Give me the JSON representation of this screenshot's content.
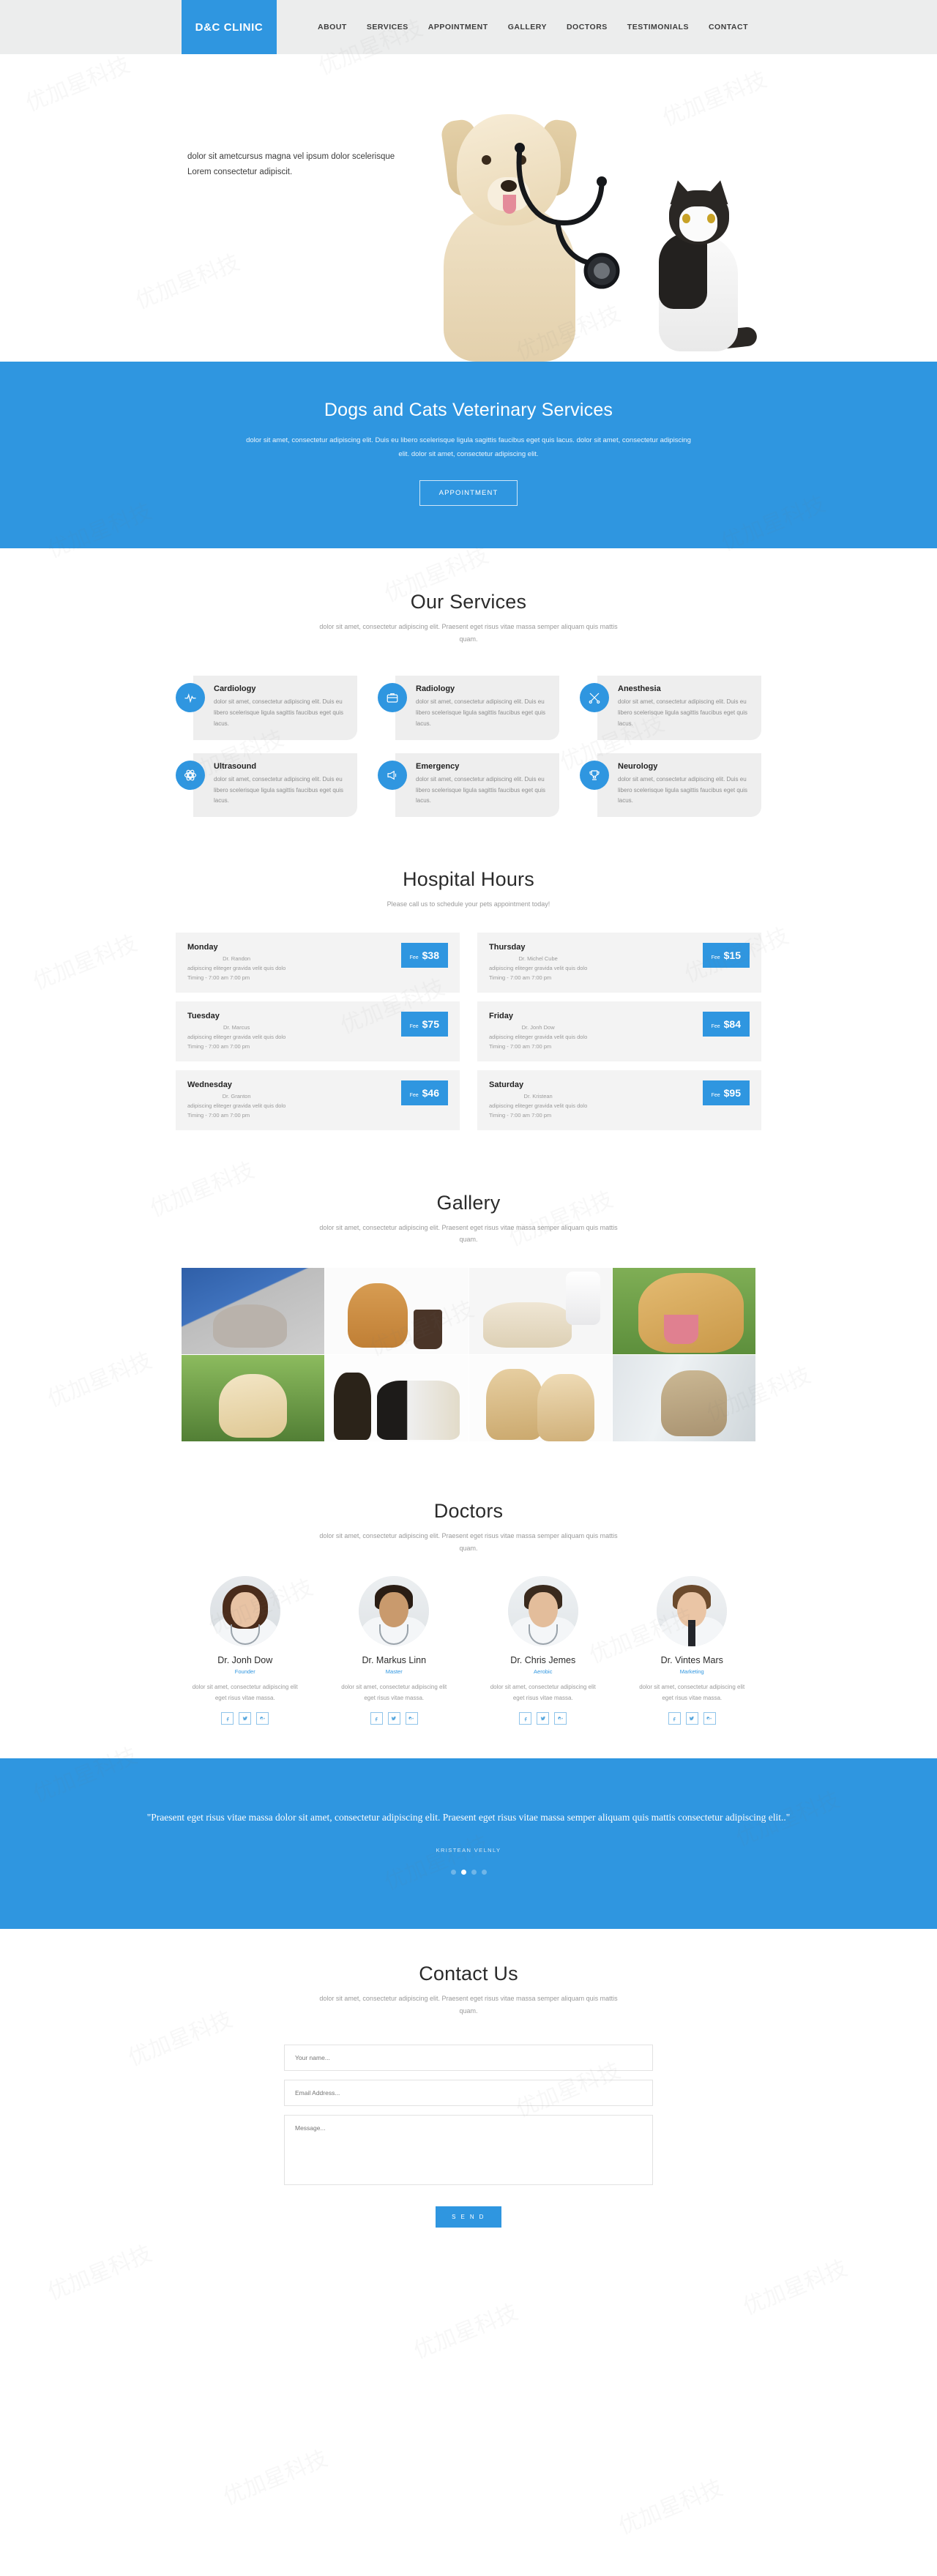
{
  "header": {
    "logo": "D&C CLINIC",
    "nav": [
      {
        "label": "ABOUT"
      },
      {
        "label": "SERVICES"
      },
      {
        "label": "APPOINTMENT"
      },
      {
        "label": "GALLERY"
      },
      {
        "label": "DOCTORS"
      },
      {
        "label": "TESTIMONIALS"
      },
      {
        "label": "CONTACT"
      }
    ]
  },
  "hero": {
    "line1": "dolor sit ametcursus magna vel ipsum dolor scelerisque",
    "line2": "Lorem consectetur adipiscit."
  },
  "banner": {
    "title": "Dogs and Cats Veterinary Services",
    "text": "dolor sit amet, consectetur adipiscing elit. Duis eu libero scelerisque ligula sagittis faucibus eget quis lacus. dolor sit amet, consectetur adipiscing elit. dolor sit amet, consectetur adipiscing elit.",
    "button": "APPOINTMENT"
  },
  "services": {
    "title": "Our Services",
    "subtitle": "dolor sit amet, consectetur adipiscing elit. Praesent eget risus vitae massa semper aliquam quis mattis quam.",
    "items": [
      {
        "icon": "heartbeat-icon",
        "title": "Cardiology",
        "text": "dolor sit amet, consectetur adipiscing elit. Duis eu libero scelerisque ligula sagittis faucibus eget quis lacus."
      },
      {
        "icon": "briefcase-icon",
        "title": "Radiology",
        "text": "dolor sit amet, consectetur adipiscing elit. Duis eu libero scelerisque ligula sagittis faucibus eget quis lacus."
      },
      {
        "icon": "scissors-icon",
        "title": "Anesthesia",
        "text": "dolor sit amet, consectetur adipiscing elit. Duis eu libero scelerisque ligula sagittis faucibus eget quis lacus."
      },
      {
        "icon": "atom-icon",
        "title": "Ultrasound",
        "text": "dolor sit amet, consectetur adipiscing elit. Duis eu libero scelerisque ligula sagittis faucibus eget quis lacus."
      },
      {
        "icon": "megaphone-icon",
        "title": "Emergency",
        "text": "dolor sit amet, consectetur adipiscing elit. Duis eu libero scelerisque ligula sagittis faucibus eget quis lacus."
      },
      {
        "icon": "trophy-icon",
        "title": "Neurology",
        "text": "dolor sit amet, consectetur adipiscing elit. Duis eu libero scelerisque ligula sagittis faucibus eget quis lacus."
      }
    ]
  },
  "hours": {
    "title": "Hospital Hours",
    "subtitle": "Please call us to schedule your pets appointment today!",
    "fee_label": "Fee",
    "items": [
      {
        "day": "Monday",
        "doctor": "Dr. Randon",
        "desc": "adipiscing eliteger gravida velit quis dolo",
        "timing": "Timing - 7:00 am 7:00 pm",
        "fee": "$38"
      },
      {
        "day": "Thursday",
        "doctor": "Dr. Michel Cube",
        "desc": "adipiscing eliteger gravida velit quis dolo",
        "timing": "Timing - 7:00 am 7:00 pm",
        "fee": "$15"
      },
      {
        "day": "Tuesday",
        "doctor": "Dr. Marcus",
        "desc": "adipiscing eliteger gravida velit quis dolo",
        "timing": "Timing - 7:00 am 7:00 pm",
        "fee": "$75"
      },
      {
        "day": "Friday",
        "doctor": "Dr. Jonh Dow",
        "desc": "adipiscing eliteger gravida velit quis dolo",
        "timing": "Timing - 7:00 am 7:00 pm",
        "fee": "$84"
      },
      {
        "day": "Wednesday",
        "doctor": "Dr. Granton",
        "desc": "adipiscing eliteger gravida velit quis dolo",
        "timing": "Timing - 7:00 am 7:00 pm",
        "fee": "$46"
      },
      {
        "day": "Saturday",
        "doctor": "Dr. Kristean",
        "desc": "adipiscing eliteger gravida velit quis dolo",
        "timing": "Timing - 7:00 am 7:00 pm",
        "fee": "$95"
      }
    ]
  },
  "gallery": {
    "title": "Gallery",
    "subtitle": "dolor sit amet, consectetur adipiscing elit. Praesent eget risus vitae massa semper aliquam quis mattis quam.",
    "items": [
      {
        "name": "vet-examining-kitten"
      },
      {
        "name": "dachshund-with-toothbrush"
      },
      {
        "name": "vet-checking-puppy"
      },
      {
        "name": "golden-retriever-outdoors"
      },
      {
        "name": "puppy-running-on-grass"
      },
      {
        "name": "group-of-dogs"
      },
      {
        "name": "two-beagles"
      },
      {
        "name": "vet-holding-kitten"
      }
    ]
  },
  "doctors": {
    "title": "Doctors",
    "subtitle": "dolor sit amet, consectetur adipiscing elit. Praesent eget risus vitae massa semper aliquam quis mattis quam.",
    "bio": "dolor sit amet, consectetur adipiscing elit eget risus vitae massa.",
    "items": [
      {
        "name": "Dr. Jonh Dow",
        "role": "Founder",
        "bio": "dolor sit amet, consectetur adipiscing elit eget risus vitae massa."
      },
      {
        "name": "Dr. Markus Linn",
        "role": "Master",
        "bio": "dolor sit amet, consectetur adipiscing elit eget risus vitae massa."
      },
      {
        "name": "Dr. Chris Jemes",
        "role": "Aerobic",
        "bio": "dolor sit amet, consectetur adipiscing elit eget risus vitae massa."
      },
      {
        "name": "Dr. Vintes Mars",
        "role": "Marketing",
        "bio": "dolor sit amet, consectetur adipiscing elit eget risus vitae massa."
      }
    ],
    "social": [
      "facebook-icon",
      "twitter-icon",
      "google-plus-icon"
    ]
  },
  "testimonials": {
    "quote": "\"Praesent eget risus vitae massa dolor sit amet, consectetur adipiscing elit. Praesent eget risus vitae massa semper aliquam quis mattis consectetur adipiscing elit..\"",
    "author": "KRISTEAN VELNLY",
    "dots": 4,
    "active_dot": 1
  },
  "contact": {
    "title": "Contact Us",
    "subtitle": "dolor sit amet, consectetur adipiscing elit. Praesent eget risus vitae massa semper aliquam quis mattis quam.",
    "name_placeholder": "Your name...",
    "email_placeholder": "Email Address...",
    "message_placeholder": "Message...",
    "send_label": "S E N D"
  },
  "colors": {
    "accent": "#2f96e0",
    "header_bg": "#eceded",
    "card_bg": "#eeeeee",
    "hour_card_bg": "#f3f3f3",
    "muted_text": "#9a9a9a"
  },
  "watermark": "优加星科技"
}
